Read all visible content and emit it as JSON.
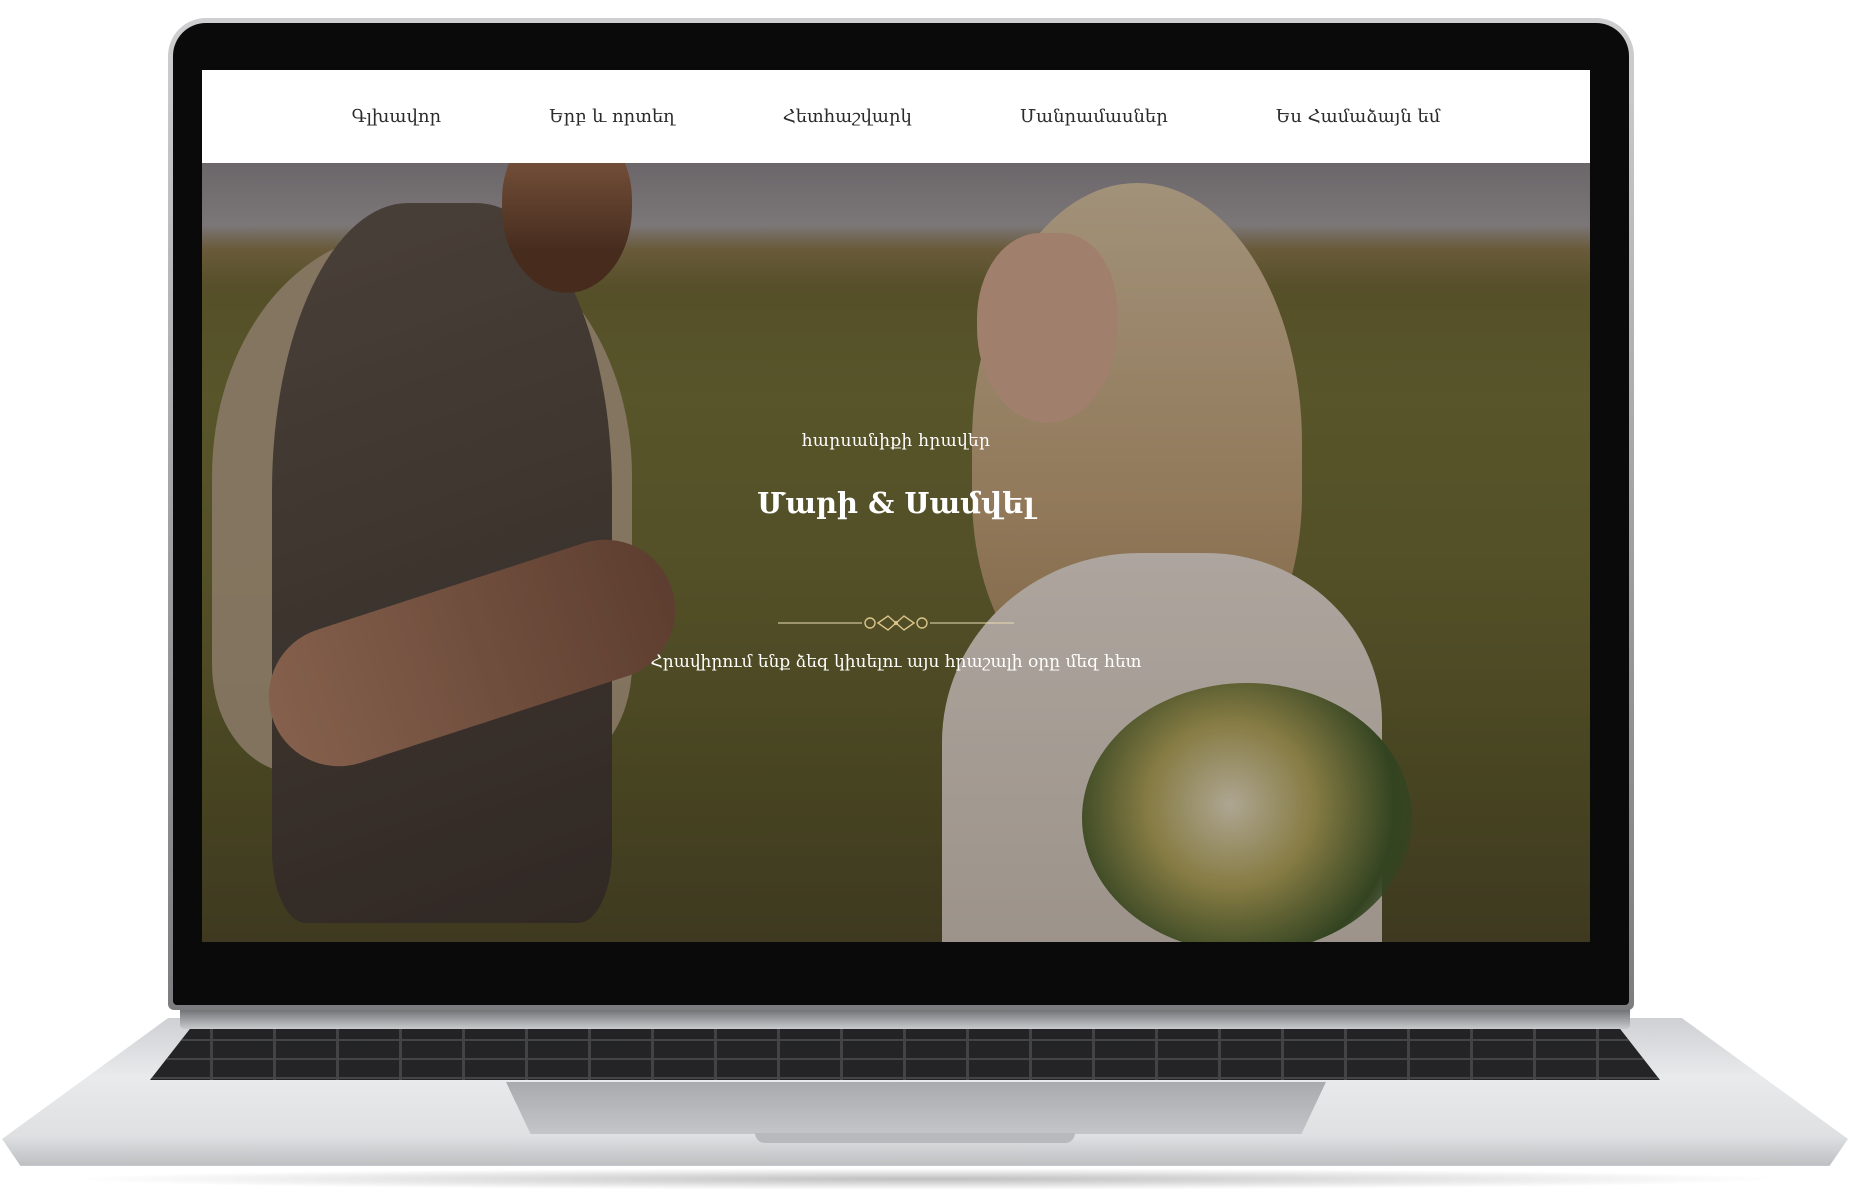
{
  "nav": {
    "items": [
      {
        "label": "Գլխավոր"
      },
      {
        "label": "Երբ և որտեղ"
      },
      {
        "label": "Հետհաշվարկ"
      },
      {
        "label": "Մանրամասներ"
      },
      {
        "label": "Ես Համաձայն եմ"
      }
    ]
  },
  "hero": {
    "subtitle": "հարսանիքի հրավեր",
    "title": "Մարի & Սամվել",
    "tagline": "Հրավիրում ենք ձեզ կիսելու այս հրաշալի օրը մեզ հետ",
    "image": "couple-photo"
  },
  "colors": {
    "nav_background": "#ffffff",
    "nav_text": "#2b2b2b",
    "hero_text": "#ffffff",
    "divider": "#d9c48a"
  },
  "icons": {
    "divider": "ornament-divider-icon"
  }
}
